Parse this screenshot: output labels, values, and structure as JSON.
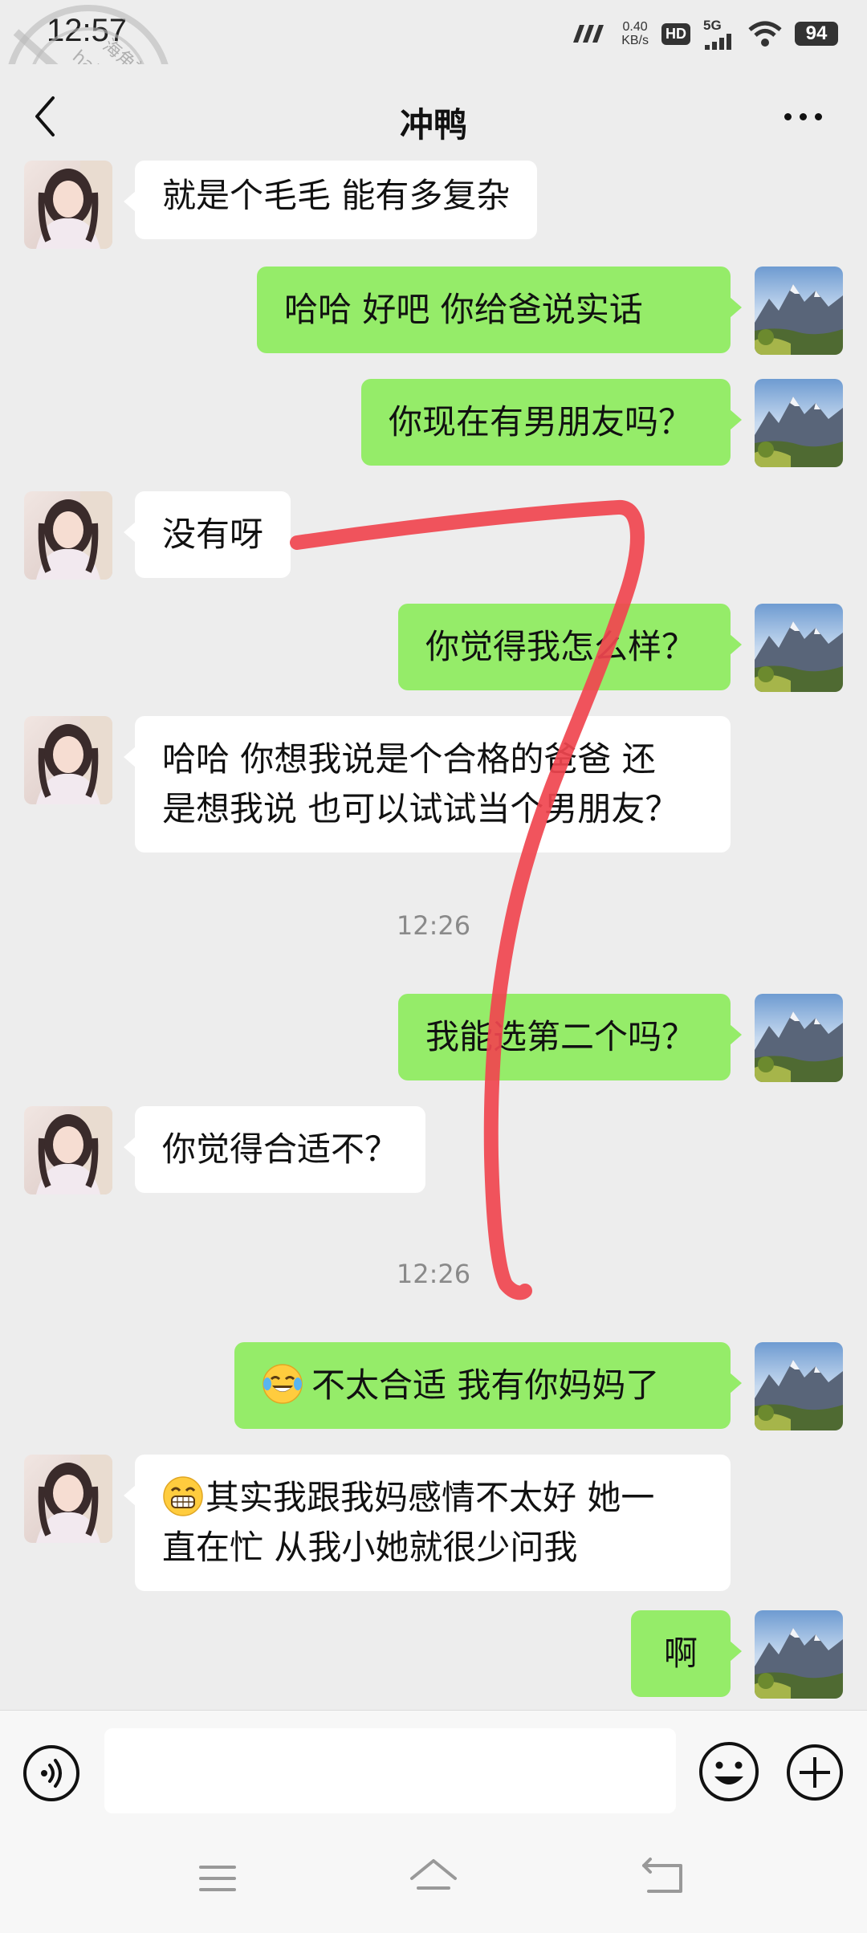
{
  "status": {
    "time": "12:57",
    "net_speed_value": "0.40",
    "net_speed_unit": "KB/s",
    "hd": "HD",
    "network": "5G",
    "battery": "94"
  },
  "watermark": {
    "line1": "海角社区",
    "line2": "haijiao.com"
  },
  "header": {
    "title": "冲鸭"
  },
  "messages": [
    {
      "side": "left",
      "text": "就是个毛毛  能有多复杂"
    },
    {
      "side": "right",
      "text": "哈哈  好吧   你给爸说实话"
    },
    {
      "side": "right",
      "text": "你现在有男朋友吗？"
    },
    {
      "side": "left",
      "text": "没有呀"
    },
    {
      "side": "right",
      "text": "你觉得我怎么样？"
    },
    {
      "side": "left",
      "line1": "哈哈  你想我说是个合格的爸爸  还",
      "line2": "是想我说  也可以试试当个男朋友？"
    },
    {
      "side": "right",
      "text": "我能选第二个吗？"
    },
    {
      "side": "left",
      "text": "你觉得合适不？"
    },
    {
      "side": "right",
      "emoji": "face-with-tears-of-joy",
      "text": "不太合适  我有你妈妈了"
    },
    {
      "side": "left",
      "emoji": "grinning-face",
      "line1": "其实我跟我妈感情不太好  她一",
      "line2": "直在忙  从我小她就很少问我"
    },
    {
      "side": "right",
      "text": "啊"
    }
  ],
  "timestamps": [
    "12:26",
    "12:26"
  ],
  "annotation": {
    "color": "#f0454f"
  },
  "colors": {
    "background": "#ededed",
    "bubble_self": "#95ec69",
    "bubble_other": "#ffffff"
  },
  "icons": {
    "voice": "voice-input-icon",
    "emoji": "emoji-icon",
    "plus": "plus-icon",
    "back": "back-chevron-icon",
    "more": "more-dots-icon"
  }
}
